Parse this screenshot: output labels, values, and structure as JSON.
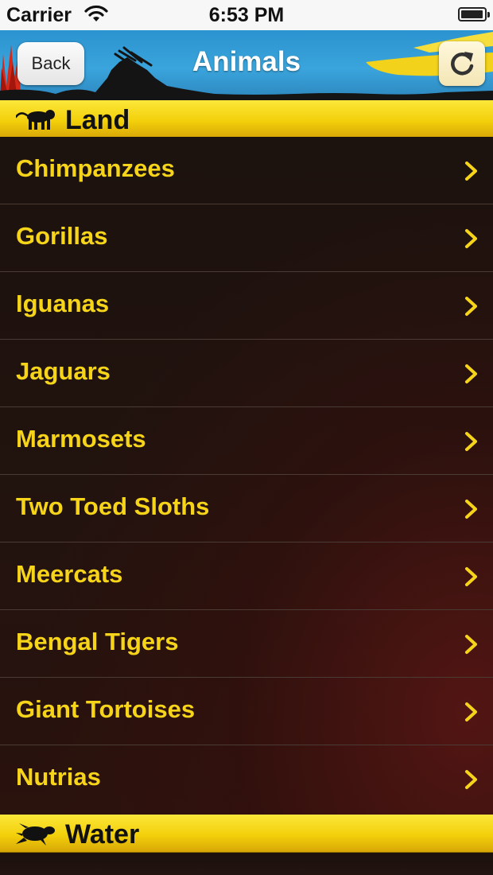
{
  "status_bar": {
    "carrier": "Carrier",
    "time": "6:53 PM",
    "battery_level": 0.95,
    "wifi_icon": "wifi-icon"
  },
  "nav": {
    "back_label": "Back",
    "title": "Animals",
    "refresh_icon": "refresh-icon"
  },
  "sections": [
    {
      "title": "Land",
      "icon": "monkey-icon",
      "items": [
        {
          "label": "Chimpanzees"
        },
        {
          "label": "Gorillas"
        },
        {
          "label": "Iguanas"
        },
        {
          "label": "Jaguars"
        },
        {
          "label": "Marmosets"
        },
        {
          "label": "Two Toed Sloths"
        },
        {
          "label": "Meercats"
        },
        {
          "label": "Bengal Tigers"
        },
        {
          "label": "Giant Tortoises"
        },
        {
          "label": "Nutrias"
        }
      ]
    },
    {
      "title": "Water",
      "icon": "turtle-icon",
      "items": []
    }
  ],
  "colors": {
    "accent_yellow": "#f6d41a",
    "nav_blue": "#2b93cf",
    "list_bg": "#1c120e"
  }
}
